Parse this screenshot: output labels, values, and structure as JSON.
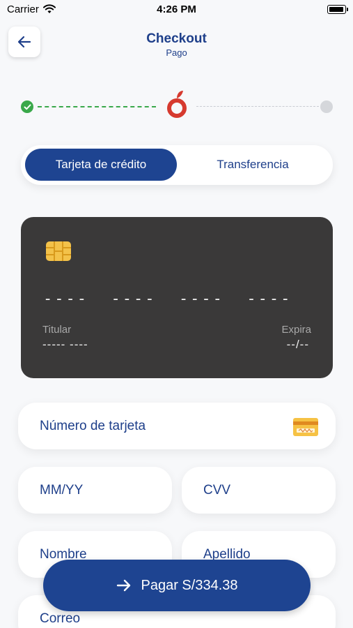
{
  "status_bar": {
    "carrier": "Carrier",
    "time": "4:26 PM"
  },
  "header": {
    "title": "Checkout",
    "subtitle": "Pago"
  },
  "tabs": [
    {
      "label": "Tarjeta de crédito",
      "active": true
    },
    {
      "label": "Transferencia",
      "active": false
    }
  ],
  "card_preview": {
    "number": "----  ----  ----  ----",
    "holder_label": "Titular",
    "holder_value": "----- ----",
    "expiry_label": "Expira",
    "expiry_value": "--/--"
  },
  "form": {
    "card_number_placeholder": "Número de tarjeta",
    "expiry_placeholder": "MM/YY",
    "cvv_placeholder": "CVV",
    "first_name_placeholder": "Nombre",
    "last_name_placeholder": "Apellido",
    "email_placeholder": "Correo"
  },
  "pay_button": {
    "label": "Pagar S/334.38"
  },
  "colors": {
    "primary": "#1e4491",
    "success": "#3aa84a",
    "brand_red": "#d63a2f",
    "card_bg": "#3a3939"
  },
  "icons": [
    "wifi-icon",
    "battery-icon",
    "back-arrow-icon",
    "check-icon",
    "brand-logo-icon",
    "chip-icon",
    "credit-card-icon",
    "arrow-right-icon"
  ]
}
